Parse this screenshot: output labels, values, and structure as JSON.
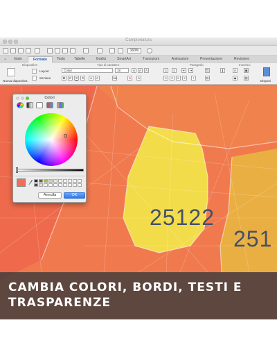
{
  "window": {
    "title": "Campionatura"
  },
  "toolbar": {
    "zoom": "160%"
  },
  "tabs": [
    "Inizio",
    "Formato",
    "Testo",
    "Tabelle",
    "Grafici",
    "SmartArt",
    "Transizioni",
    "Animazioni",
    "Presentazione",
    "Revisione"
  ],
  "ribbon": {
    "groups": [
      "Diapositive",
      "Tipo di carattere",
      "Paragrafo",
      "Inserisci"
    ],
    "new_slide": "Nuova diapositiva",
    "layout": "Layout",
    "section": "Sezione",
    "font_name": "Colori",
    "font_size": "18",
    "arrange": "Disponi"
  },
  "color_dialog": {
    "title": "Colori",
    "current_color": "#f26d5b",
    "cancel_label": "Annulla",
    "ok_label": "OK"
  },
  "map": {
    "zip_primary": "25122",
    "zip_secondary": "251",
    "colors": {
      "orange": "#f07a4e",
      "yellow": "#f2e14a",
      "amber": "#e9b541"
    }
  },
  "banner": {
    "line1": "CAMBIA COLORI, BORDI, TESTI E",
    "line2": "TRASPARENZE"
  }
}
